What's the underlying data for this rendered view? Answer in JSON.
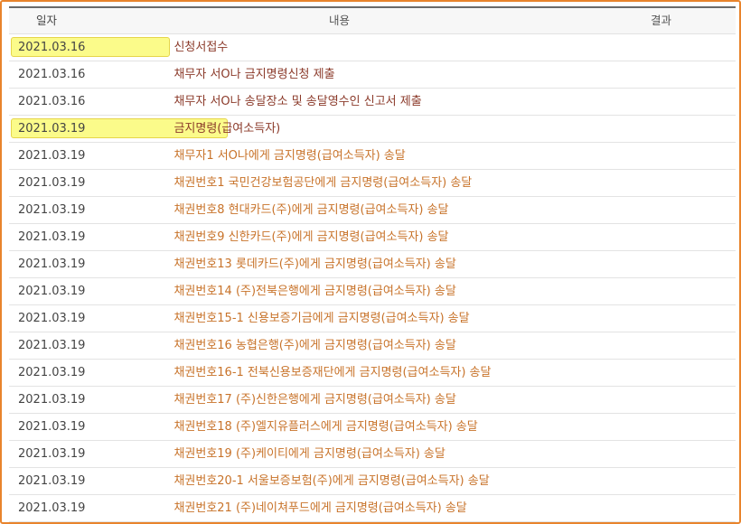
{
  "header": {
    "date": "일자",
    "content": "내용",
    "result": "결과"
  },
  "rows": [
    {
      "date": "2021.03.16",
      "content": "신청서접수",
      "style": "brown",
      "highlight": true
    },
    {
      "date": "2021.03.16",
      "content": "채무자 서O나 금지명령신청 제출",
      "style": "brown",
      "highlight": false
    },
    {
      "date": "2021.03.16",
      "content": "채무자 서O나 송달장소 및 송달영수인 신고서 제출",
      "style": "brown",
      "highlight": false
    },
    {
      "date": "2021.03.19",
      "content": "금지명령(급여소득자)",
      "style": "brown",
      "highlight": true
    },
    {
      "date": "2021.03.19",
      "content": "채무자1 서O나에게 금지명령(급여소득자) 송달",
      "style": "orange",
      "highlight": false
    },
    {
      "date": "2021.03.19",
      "content": "채권번호1 국민건강보험공단에게 금지명령(급여소득자) 송달",
      "style": "orange",
      "highlight": false
    },
    {
      "date": "2021.03.19",
      "content": "채권번호8 현대카드(주)에게 금지명령(급여소득자) 송달",
      "style": "orange",
      "highlight": false
    },
    {
      "date": "2021.03.19",
      "content": "채권번호9 신한카드(주)에게 금지명령(급여소득자) 송달",
      "style": "orange",
      "highlight": false
    },
    {
      "date": "2021.03.19",
      "content": "채권번호13 롯데카드(주)에게 금지명령(급여소득자) 송달",
      "style": "orange",
      "highlight": false
    },
    {
      "date": "2021.03.19",
      "content": "채권번호14 (주)전북은행에게 금지명령(급여소득자) 송달",
      "style": "orange",
      "highlight": false
    },
    {
      "date": "2021.03.19",
      "content": "채권번호15-1 신용보증기금에게 금지명령(급여소득자) 송달",
      "style": "orange",
      "highlight": false
    },
    {
      "date": "2021.03.19",
      "content": "채권번호16 농협은행(주)에게 금지명령(급여소득자) 송달",
      "style": "orange",
      "highlight": false
    },
    {
      "date": "2021.03.19",
      "content": "채권번호16-1 전북신용보증재단에게 금지명령(급여소득자) 송달",
      "style": "orange",
      "highlight": false
    },
    {
      "date": "2021.03.19",
      "content": "채권번호17 (주)신한은행에게 금지명령(급여소득자) 송달",
      "style": "orange",
      "highlight": false
    },
    {
      "date": "2021.03.19",
      "content": "채권번호18 (주)엘지유플러스에게 금지명령(급여소득자) 송달",
      "style": "orange",
      "highlight": false
    },
    {
      "date": "2021.03.19",
      "content": "채권번호19 (주)케이티에게 금지명령(급여소득자) 송달",
      "style": "orange",
      "highlight": false
    },
    {
      "date": "2021.03.19",
      "content": "채권번호20-1 서울보증보험(주)에게 금지명령(급여소득자) 송달",
      "style": "orange",
      "highlight": false
    },
    {
      "date": "2021.03.19",
      "content": "채권번호21 (주)네이쳐푸드에게 금지명령(급여소득자) 송달",
      "style": "orange",
      "highlight": false
    }
  ]
}
